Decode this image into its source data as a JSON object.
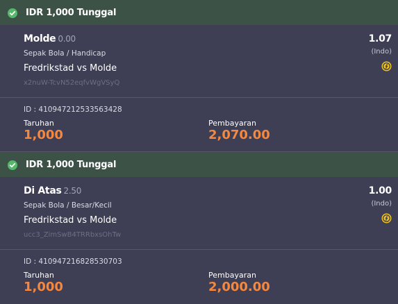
{
  "colors": {
    "background": "#3e3e55",
    "header_bg": "#3d5247",
    "check": "#56b86a",
    "accent_orange": "#f5883f",
    "coin": "#f0c419"
  },
  "bets": [
    {
      "header": "IDR 1,000 Tunggal",
      "pick": "Molde",
      "line": "0.00",
      "market": "Sepak Bola / Handicap",
      "match": "Fredrikstad vs Molde",
      "code": "x2nuW-TcvN52eqfvWgVSyQ",
      "odds": "1.07",
      "odds_type": "(Indo)",
      "bet_id": "ID : 410947212533563428",
      "stake_label": "Taruhan",
      "stake": "1,000",
      "payout_label": "Pembayaran",
      "payout": "2,070.00"
    },
    {
      "header": "IDR 1,000 Tunggal",
      "pick": "Di Atas",
      "line": "2.50",
      "market": "Sepak Bola / Besar/Kecil",
      "match": "Fredrikstad vs Molde",
      "code": "ucc3_ZimSwB4TRRbxsOhTw",
      "odds": "1.00",
      "odds_type": "(Indo)",
      "bet_id": "ID : 410947216828530703",
      "stake_label": "Taruhan",
      "stake": "1,000",
      "payout_label": "Pembayaran",
      "payout": "2,000.00"
    }
  ]
}
